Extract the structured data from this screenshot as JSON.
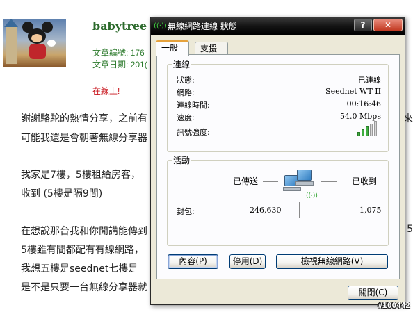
{
  "post": {
    "username": "babytree",
    "article_no_label": "文章編號: 176",
    "article_date_label": "文章日期: 201(",
    "online_status": "在線上!",
    "lines": [
      "謝謝駱駝的熱情分享，之前有",
      "可能我還是會朝著無線分享器",
      "我家是7樓，5樓租給房客，",
      "收到 (5樓是隔9間)",
      "在想說那台我和你閒講能傳到",
      "5樓雖有間都配有有線網路，",
      "我想五樓是seednet七樓是",
      "是不是只要一台無線分享器就"
    ],
    "right_edge_chars": [
      "來",
      "5"
    ]
  },
  "dialog": {
    "title": "無線網路連線 狀態",
    "help_button": "?",
    "close_button": "✕",
    "tabs": [
      {
        "label": "一般",
        "active": true
      },
      {
        "label": "支援",
        "active": false
      }
    ],
    "connection": {
      "group_label": "連線",
      "rows": [
        {
          "key": "狀態:",
          "value": "已連線"
        },
        {
          "key": "網路:",
          "value": "Seednet WT II"
        },
        {
          "key": "連線時間:",
          "value": "00:16:46"
        },
        {
          "key": "速度:",
          "value": "54.0 Mbps"
        },
        {
          "key": "訊號強度:",
          "value": ""
        }
      ],
      "signal_bars_filled": 3,
      "signal_bars_total": 5
    },
    "activity": {
      "group_label": "活動",
      "sent_label": "已傳送",
      "received_label": "已收到",
      "packets_label": "封包:",
      "packets_sent": "246,630",
      "packets_received": "1,075"
    },
    "buttons": {
      "properties": "內容(P)",
      "disable": "停用(D)",
      "view_networks": "檢視無線網路(V)",
      "close": "關閉(C)"
    }
  },
  "watermark": "#100442",
  "colors": {
    "username": "#2c6a2c",
    "meta_text": "#2c7a2c",
    "online": "#c8141c",
    "titlebar": "#141414",
    "dialog_bg": "#ece9d8",
    "signal_green": "#3eae3e"
  }
}
